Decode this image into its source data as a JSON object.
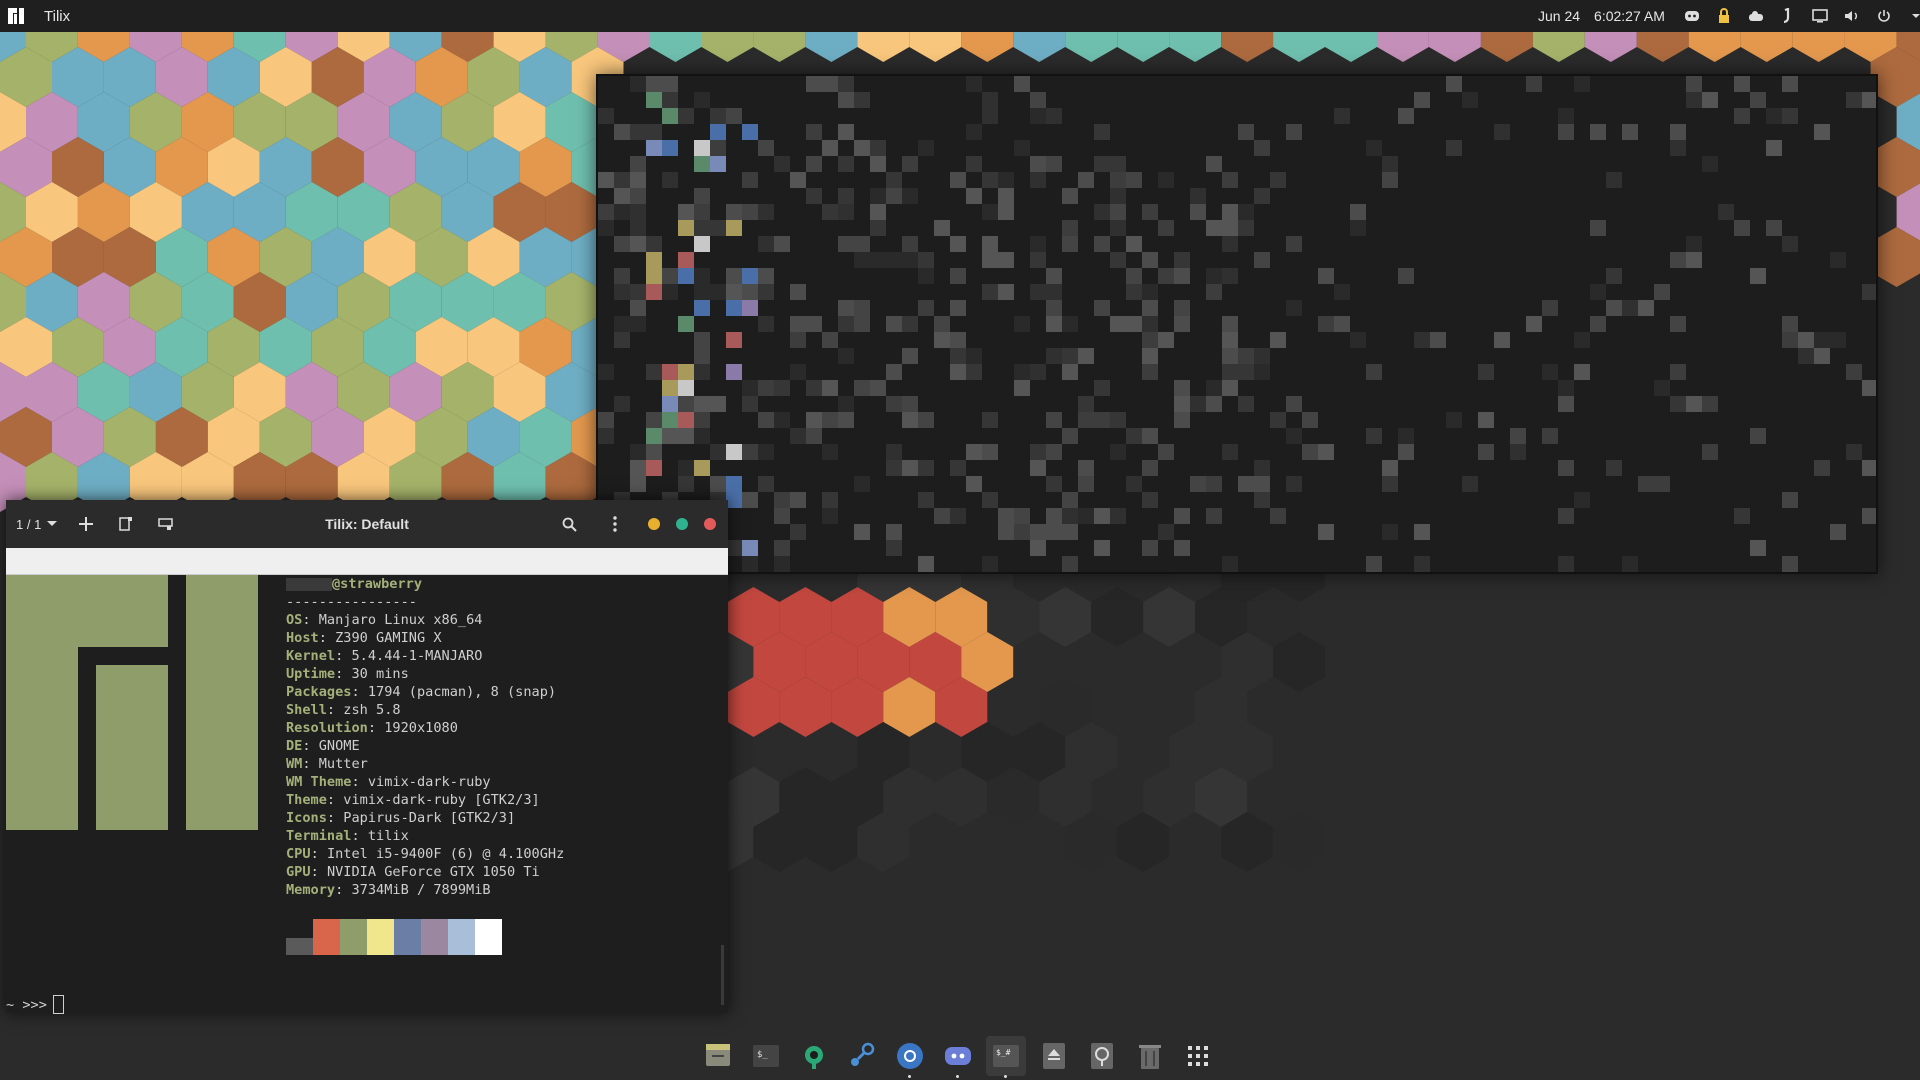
{
  "topbar": {
    "app_name": "Tilix",
    "date": "Jun 24",
    "time": "6:02:27 AM",
    "tray_icons": [
      "discord-icon",
      "lock-icon",
      "cloud-icon",
      "steam-icon",
      "screen-icon",
      "volume-icon",
      "power-icon",
      "chevron-down-icon"
    ]
  },
  "tilix": {
    "session_label": "1 / 1",
    "title": "Tilix: Default"
  },
  "neofetch": {
    "user": "@strawberry",
    "separator": "----------------",
    "lines": [
      {
        "key": "OS",
        "value": "Manjaro Linux x86_64"
      },
      {
        "key": "Host",
        "value": "Z390 GAMING X"
      },
      {
        "key": "Kernel",
        "value": "5.4.44-1-MANJARO"
      },
      {
        "key": "Uptime",
        "value": "30 mins"
      },
      {
        "key": "Packages",
        "value": "1794 (pacman), 8 (snap)"
      },
      {
        "key": "Shell",
        "value": "zsh 5.8"
      },
      {
        "key": "Resolution",
        "value": "1920x1080"
      },
      {
        "key": "DE",
        "value": "GNOME"
      },
      {
        "key": "WM",
        "value": "Mutter"
      },
      {
        "key": "WM Theme",
        "value": "vimix-dark-ruby"
      },
      {
        "key": "Theme",
        "value": "vimix-dark-ruby [GTK2/3]"
      },
      {
        "key": "Icons",
        "value": "Papirus-Dark [GTK2/3]"
      },
      {
        "key": "Terminal",
        "value": "tilix"
      },
      {
        "key": "CPU",
        "value": "Intel i5-9400F (6) @ 4.100GHz"
      },
      {
        "key": "GPU",
        "value": "NVIDIA GeForce GTX 1050 Ti"
      },
      {
        "key": "Memory",
        "value": "3734MiB / 7899MiB"
      }
    ],
    "palette": [
      "#5a5a5a",
      "#d9664a",
      "#8f9d6a",
      "#f0e68c",
      "#6b7fa6",
      "#9c87a1",
      "#a9bfd9",
      "#ffffff"
    ]
  },
  "prompt": "~ >>>",
  "colors": {
    "accent_green": "#a4b07a",
    "logo_green": "#8f9d6a",
    "min_yellow": "#e8b02e",
    "max_green": "#2fb38e",
    "close_red": "#e35a5a"
  },
  "dock": [
    {
      "name": "dock-files",
      "icon": "files-icon"
    },
    {
      "name": "dock-terminal",
      "icon": "terminal-icon"
    },
    {
      "name": "dock-settings",
      "icon": "wrench-icon"
    },
    {
      "name": "dock-steam",
      "icon": "steam-icon"
    },
    {
      "name": "dock-chromium",
      "icon": "chromium-icon"
    },
    {
      "name": "dock-discord",
      "icon": "discord-icon"
    },
    {
      "name": "dock-tilix",
      "icon": "tilix-icon"
    },
    {
      "name": "dock-eject",
      "icon": "eject-icon"
    },
    {
      "name": "dock-disk",
      "icon": "disk-icon"
    },
    {
      "name": "dock-trash",
      "icon": "trash-icon"
    },
    {
      "name": "dock-app-grid",
      "icon": "app-grid-icon"
    }
  ]
}
